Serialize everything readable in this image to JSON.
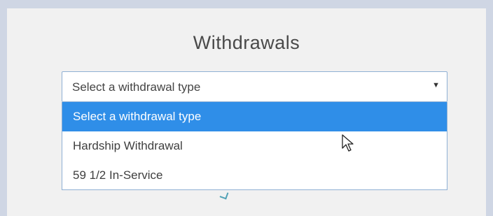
{
  "page": {
    "title": "Withdrawals"
  },
  "withdrawal_select": {
    "selected_value": "Select a withdrawal type",
    "caret_icon": "caret-down-icon",
    "options": [
      {
        "label": "Select a withdrawal type",
        "highlighted": true
      },
      {
        "label": "Hardship Withdrawal",
        "highlighted": false
      },
      {
        "label": "59 1/2 In-Service",
        "highlighted": false
      }
    ]
  },
  "colors": {
    "highlight": "#2f8ee8",
    "border": "#8fb0d4",
    "panel_bg": "#f1f1f1",
    "outer_bg": "#cfd6e4"
  },
  "icons": {
    "cursor": "mouse-pointer-icon"
  }
}
